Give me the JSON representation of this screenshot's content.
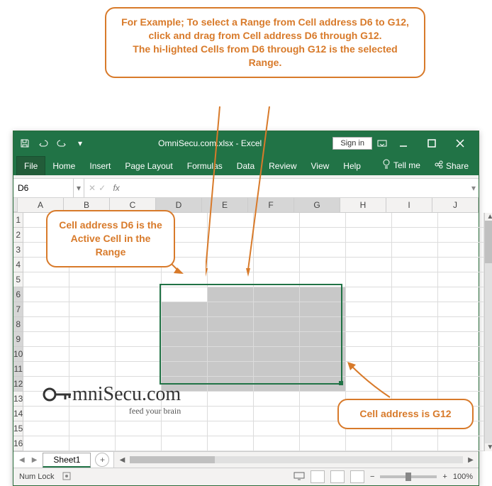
{
  "callouts": {
    "top": "For Example; To select a Range from Cell address D6 to G12, click and drag from Cell address D6 through G12.\nThe hi-lighted Cells from D6 through G12 is the selected Range.",
    "left": "Cell address D6 is the Active Cell in the Range",
    "right": "Cell address is G12"
  },
  "titlebar": {
    "app_title": "OmniSecu.com.xlsx - Excel",
    "signin": "Sign in"
  },
  "ribbon": {
    "tabs": [
      "File",
      "Home",
      "Insert",
      "Page Layout",
      "Formulas",
      "Data",
      "Review",
      "View",
      "Help"
    ],
    "tellme": "Tell me",
    "share": "Share"
  },
  "formula_bar": {
    "name_box": "D6",
    "fx_label": "fx",
    "formula": ""
  },
  "grid": {
    "columns": [
      "A",
      "B",
      "C",
      "D",
      "E",
      "F",
      "G",
      "H",
      "I",
      "J"
    ],
    "rows": [
      "1",
      "2",
      "3",
      "4",
      "5",
      "6",
      "7",
      "8",
      "9",
      "10",
      "11",
      "12",
      "13",
      "14",
      "15",
      "16"
    ],
    "selected_cols": [
      "D",
      "E",
      "F",
      "G"
    ],
    "selected_rows": [
      "6",
      "7",
      "8",
      "9",
      "10",
      "11",
      "12"
    ],
    "active_cell": "D6"
  },
  "sheet_tabs": {
    "active": "Sheet1"
  },
  "statusbar": {
    "left": "Num Lock",
    "zoom": "100%"
  },
  "logo": {
    "main": "mniSecu.com",
    "sub": "feed your brain"
  }
}
